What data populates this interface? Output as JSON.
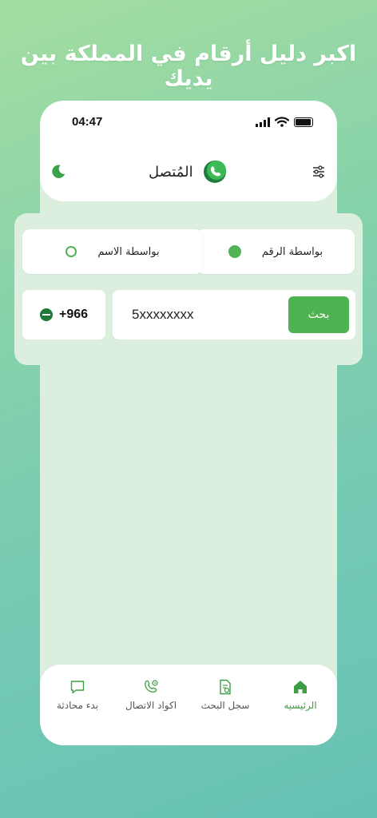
{
  "headline": "اكبر دليل أرقام في المملكة بين يديك",
  "status_bar": {
    "time": "04:47"
  },
  "app": {
    "title": "المُتصل"
  },
  "search_mode": {
    "by_number": "بواسطة الرقم",
    "by_name": "بواسطة الاسم",
    "selected": "by_number"
  },
  "country_code": "+966",
  "search": {
    "value": "5xxxxxxxx",
    "button": "بحث"
  },
  "nav": {
    "home": "الرئيسيه",
    "history": "سجل البحث",
    "codes": "اكواد الاتصال",
    "chat": "بدء محادثة"
  },
  "colors": {
    "accent": "#4db250",
    "background_top": "#a4dda0",
    "background_bottom": "#67c2b4"
  }
}
